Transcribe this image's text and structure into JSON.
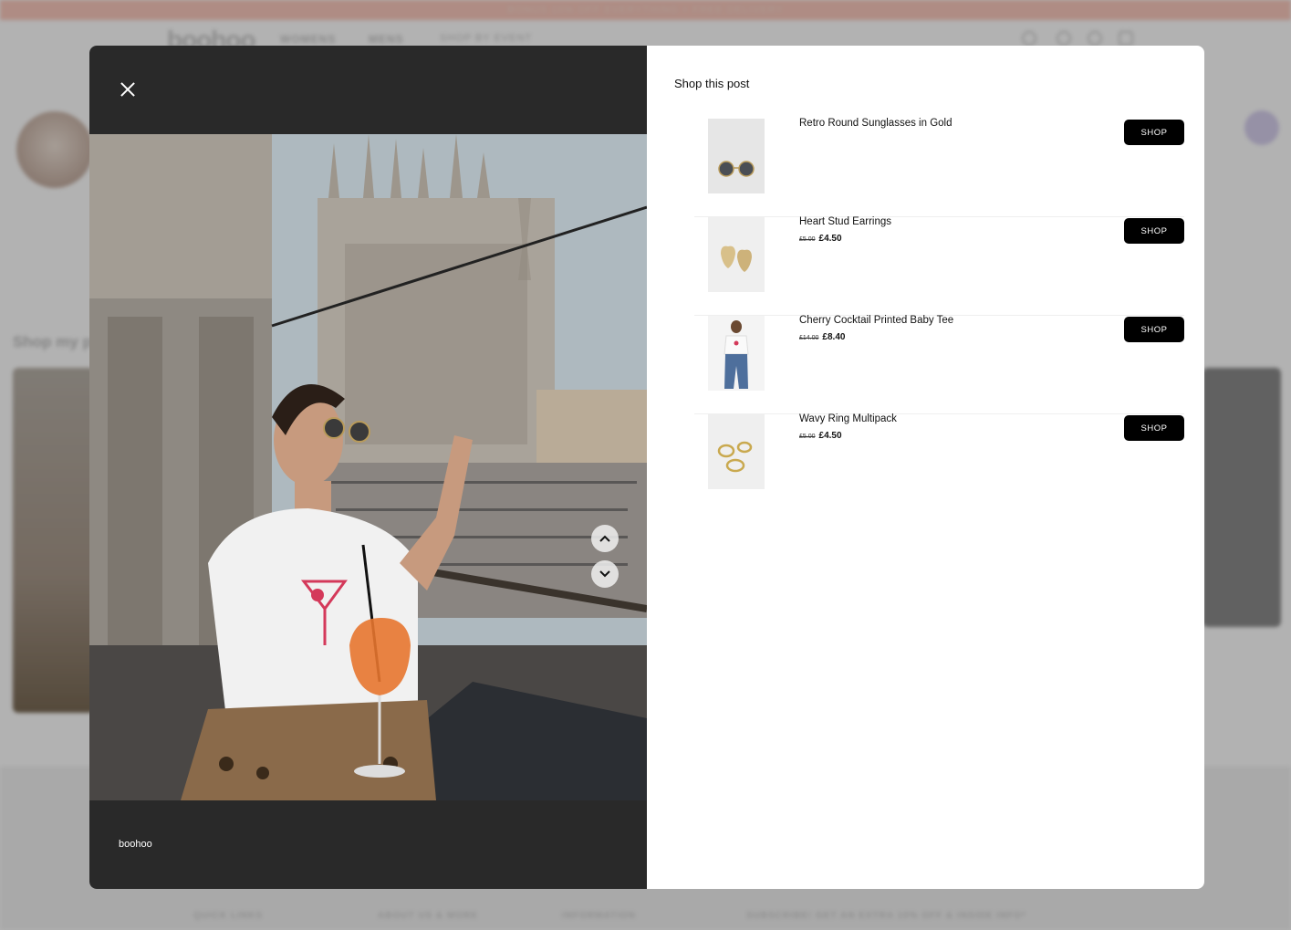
{
  "background": {
    "promo_text": "BONUS 10% OFF EVERYTHING + FREE DELIVERY",
    "logo": "boohoo",
    "nav": [
      "WOMENS",
      "MENS",
      "SHOP BY EVENT"
    ],
    "section_heading": "Shop my po",
    "footer_columns": [
      "QUICK LINKS",
      "ABOUT US & MORE",
      "INFORMATION",
      "SUBSCRIBE! GET AN EXTRA 10% OFF & INSIDE INFO*"
    ]
  },
  "modal": {
    "caption": "boohoo",
    "shop_title": "Shop this post",
    "shop_button_label": "SHOP",
    "products": [
      {
        "name": "Retro Round Sunglasses in Gold",
        "was": "",
        "now": ""
      },
      {
        "name": "Heart Stud Earrings",
        "was": "£5.00",
        "now": "£4.50"
      },
      {
        "name": "Cherry Cocktail Printed Baby Tee",
        "was": "£14.00",
        "now": "£8.40"
      },
      {
        "name": "Wavy Ring Multipack",
        "was": "£5.00",
        "now": "£4.50"
      }
    ]
  },
  "colors": {
    "promo": "#fbc9bd",
    "media_bg": "#292929",
    "button": "#000000"
  }
}
